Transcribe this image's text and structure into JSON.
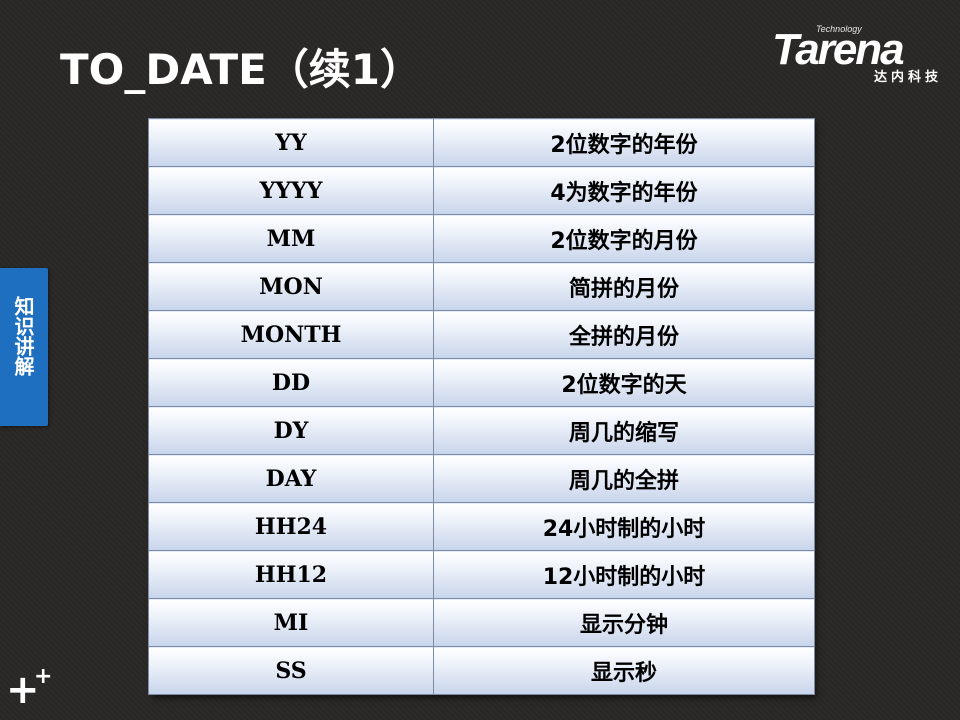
{
  "slide": {
    "title": "TO_DATE（续1）",
    "side_tab": "知识讲解",
    "logo": {
      "tech": "Technology",
      "brand": "Tarena",
      "cn": "达内科技"
    },
    "bottom_mark": {
      "big": "+",
      "small": "+"
    }
  },
  "table": {
    "rows": [
      {
        "format": "YY",
        "desc": "2位数字的年份"
      },
      {
        "format": "YYYY",
        "desc": "4为数字的年份"
      },
      {
        "format": "MM",
        "desc": "2位数字的月份"
      },
      {
        "format": "MON",
        "desc": "简拼的月份"
      },
      {
        "format": "MONTH",
        "desc": "全拼的月份"
      },
      {
        "format": "DD",
        "desc": "2位数字的天"
      },
      {
        "format": "DY",
        "desc": "周几的缩写"
      },
      {
        "format": "DAY",
        "desc": "周几的全拼"
      },
      {
        "format": "HH24",
        "desc": "24小时制的小时"
      },
      {
        "format": "HH12",
        "desc": "12小时制的小时"
      },
      {
        "format": "MI",
        "desc": "显示分钟"
      },
      {
        "format": "SS",
        "desc": "显示秒"
      }
    ]
  },
  "colors": {
    "background": "#2a2727",
    "side_tab": "#1f6fc0",
    "cell_top": "#ffffff",
    "cell_bottom": "#c7d4ea",
    "border": "#7e8ca3"
  }
}
